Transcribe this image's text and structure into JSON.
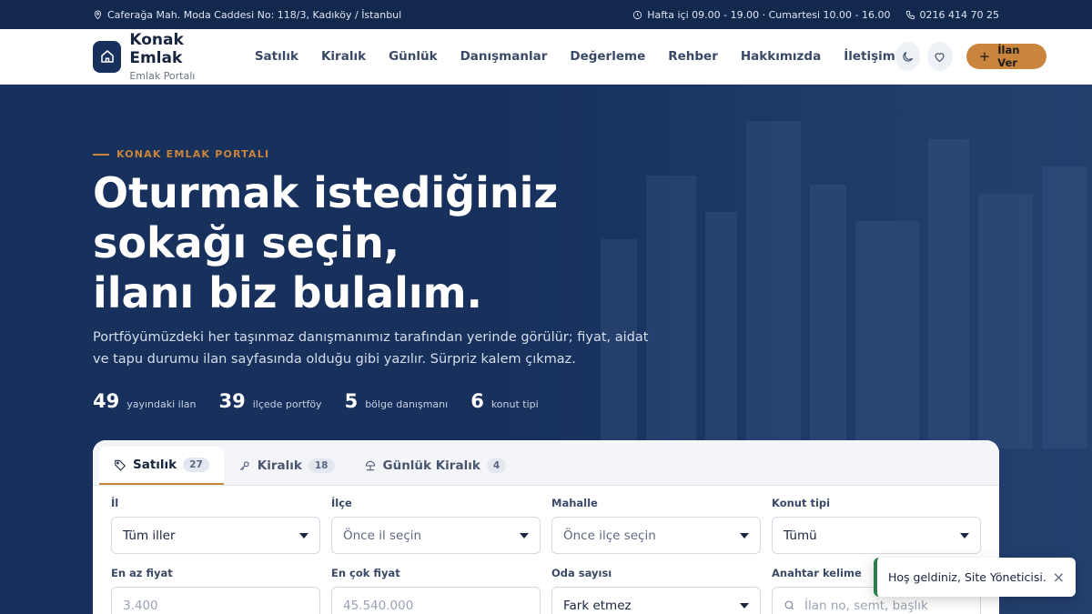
{
  "topbar": {
    "address": "Caferağa Mah. Moda Caddesi No: 118/3, Kadıköy / İstanbul",
    "hours": "Hafta içi 09.00 - 19.00 · Cumartesi 10.00 - 16.00",
    "phone": "0216 414 70 25"
  },
  "header": {
    "brand_name": "Konak Emlak",
    "brand_sub": "Emlak Portalı",
    "nav": [
      "Satılık",
      "Kiralık",
      "Günlük",
      "Danışmanlar",
      "Değerleme",
      "Rehber",
      "Hakkımızda",
      "İletişim"
    ],
    "cta_label": "İlan Ver",
    "cta_plus": "+"
  },
  "hero": {
    "eyebrow": "KONAK EMLAK PORTALI",
    "headline": [
      "Oturmak istediğiniz",
      "sokağı seçin,",
      "ilanı biz bulalım."
    ],
    "lead": "Portföyümüzdeki her taşınmaz danışmanımız tarafından yerinde görülür; fiyat, aidat ve tapu durumu ilan sayfasında olduğu gibi yazılır. Sürpriz kalem çıkmaz.",
    "stats": [
      {
        "num": "49",
        "label": "yayındaki ilan"
      },
      {
        "num": "39",
        "label": "ilçede portföy"
      },
      {
        "num": "5",
        "label": "bölge danışmanı"
      },
      {
        "num": "6",
        "label": "konut tipi"
      }
    ]
  },
  "search": {
    "tabs": [
      {
        "label": "Satılık",
        "count": "27"
      },
      {
        "label": "Kiralık",
        "count": "18"
      },
      {
        "label": "Günlük Kiralık",
        "count": "4"
      }
    ],
    "fields": {
      "il": {
        "label": "İl",
        "value": "Tüm iller"
      },
      "ilce": {
        "label": "İlçe",
        "value": "Önce il seçin"
      },
      "mahalle": {
        "label": "Mahalle",
        "value": "Önce ilçe seçin"
      },
      "konut_tipi": {
        "label": "Konut tipi",
        "value": "Tümü"
      },
      "min_fiyat": {
        "label": "En az fiyat",
        "placeholder": "3.400"
      },
      "max_fiyat": {
        "label": "En çok fiyat",
        "placeholder": "45.540.000"
      },
      "oda": {
        "label": "Oda sayısı",
        "value": "Fark etmez"
      },
      "anahtar": {
        "label": "Anahtar kelime",
        "placeholder": "İlan no, semt, başlık"
      }
    }
  },
  "toast": {
    "message": "Hoş geldiniz, Site Yöneticisi.",
    "close": "×"
  },
  "colors": {
    "navy": "#17305c",
    "accent": "#c9853b",
    "success": "#2f7d4f"
  }
}
